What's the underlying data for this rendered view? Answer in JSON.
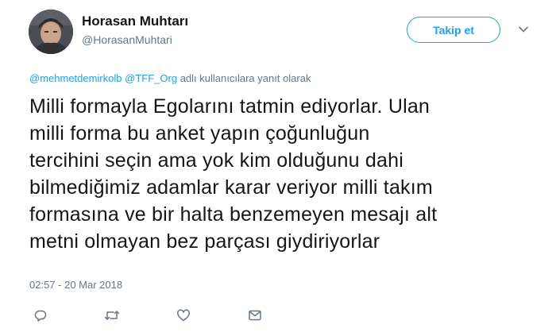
{
  "author": {
    "display_name": "Horasan Muhtarı",
    "screen_name": "@HorasanMuhtari"
  },
  "follow_button": {
    "label": "Takip et"
  },
  "reply_context": {
    "mention_1": "@mehmetdemirkolb",
    "mention_2": "@TFF_Org",
    "suffix": "adlı kullanıcılara yanıt olarak"
  },
  "tweet": {
    "lines": [
      "Milli formayla Egolarını tatmin ediyorlar. Ulan",
      "milli forma bu anket yapın çoğunluğun",
      "tercihini seçin ama yok kim olduğunu dahi",
      "bilmediğimiz adamlar karar veriyor milli takım",
      "formasına ve bir halta benzemeyen mesajı alt",
      "metni olmayan bez parçası giydiriyorlar"
    ],
    "timestamp": "02:57 - 20 Mar 2018"
  },
  "actions": {
    "icons": [
      "reply-icon",
      "retweet-icon",
      "like-icon",
      "direct-message-icon"
    ]
  },
  "colors": {
    "accent": "#1da1f2",
    "secondary_text": "#657786",
    "primary_text": "#14171a"
  }
}
